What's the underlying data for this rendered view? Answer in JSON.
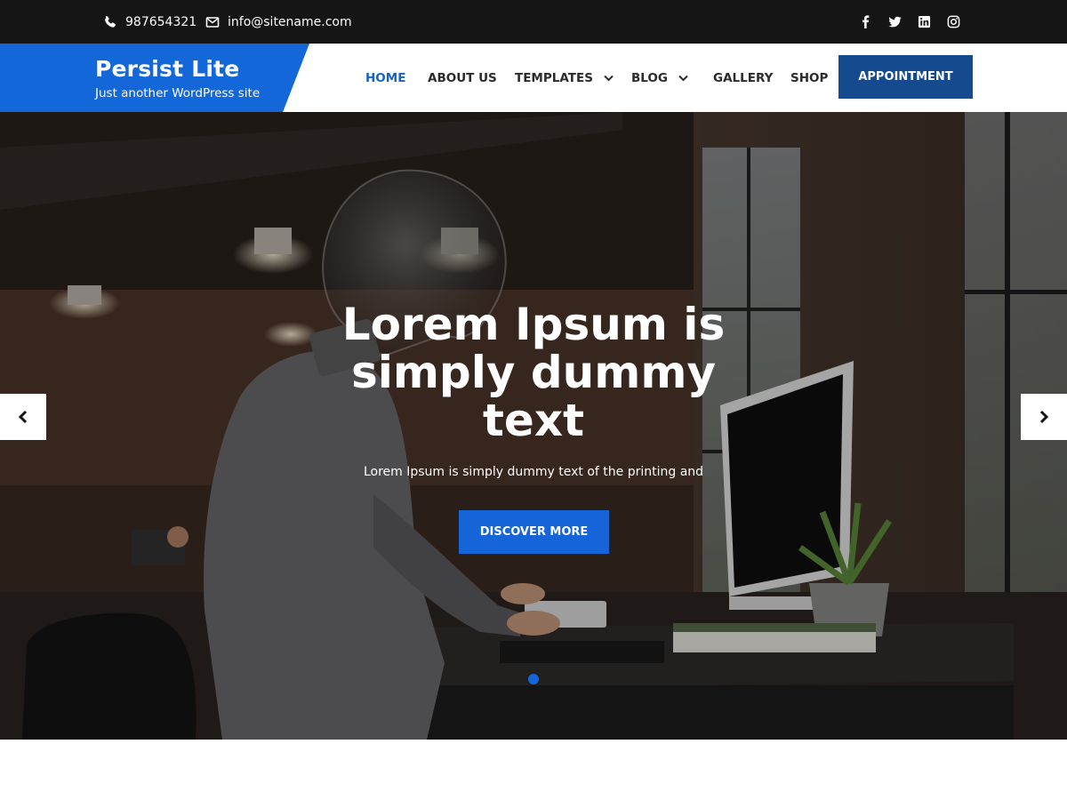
{
  "topbar": {
    "phone": "987654321",
    "email": "info@sitename.com",
    "phone_icon": "phone-icon",
    "email_icon": "envelope-icon",
    "social": [
      "facebook-icon",
      "twitter-icon",
      "linkedin-icon",
      "instagram-icon"
    ]
  },
  "brand": {
    "title": "Persist Lite",
    "tagline": "Just another WordPress site",
    "accent_color": "#1565d8"
  },
  "nav": {
    "items": [
      {
        "label": "HOME",
        "active": true
      },
      {
        "label": "ABOUT US"
      },
      {
        "label": "TEMPLATES",
        "dropdown": true
      },
      {
        "label": "BLOG",
        "dropdown": true
      },
      {
        "label": "GALLERY"
      },
      {
        "label": "SHOP"
      }
    ],
    "cta_label": "APPOINTMENT",
    "cta_color": "#164a8f"
  },
  "hero": {
    "title": "Lorem Ipsum is simply dummy text",
    "subtitle": "Lorem Ipsum is simply dummy text of the printing and",
    "button_label": "DISCOVER MORE",
    "button_color": "#1565d8",
    "prev_icon": "chevron-left-icon",
    "next_icon": "chevron-right-icon",
    "slide_count": 1,
    "active_slide": 1
  }
}
